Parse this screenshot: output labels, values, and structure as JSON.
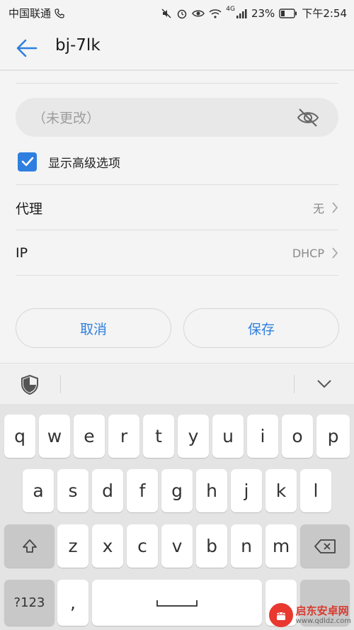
{
  "status_bar": {
    "carrier": "中国联通",
    "battery": "23%",
    "time": "下午2:54",
    "network": "4G"
  },
  "header": {
    "title": "bj-7lk"
  },
  "password": {
    "placeholder": "（未更改）"
  },
  "advanced": {
    "label": "显示高级选项",
    "checked": true
  },
  "proxy": {
    "label": "代理",
    "value": "无"
  },
  "ip": {
    "label": "IP",
    "value": "DHCP"
  },
  "buttons": {
    "cancel": "取消",
    "save": "保存"
  },
  "keyboard": {
    "row1": [
      "q",
      "w",
      "e",
      "r",
      "t",
      "y",
      "u",
      "i",
      "o",
      "p"
    ],
    "row2": [
      "a",
      "s",
      "d",
      "f",
      "g",
      "h",
      "j",
      "k",
      "l"
    ],
    "row3": [
      "z",
      "x",
      "c",
      "v",
      "b",
      "n",
      "m"
    ],
    "symbols": "?123",
    "comma": ","
  },
  "watermark": {
    "name": "启东安卓网",
    "url": "www.qdldz.com"
  },
  "colors": {
    "accent": "#2e7fe0",
    "background": "#f4f4f4",
    "watermark": "#e8382f"
  }
}
